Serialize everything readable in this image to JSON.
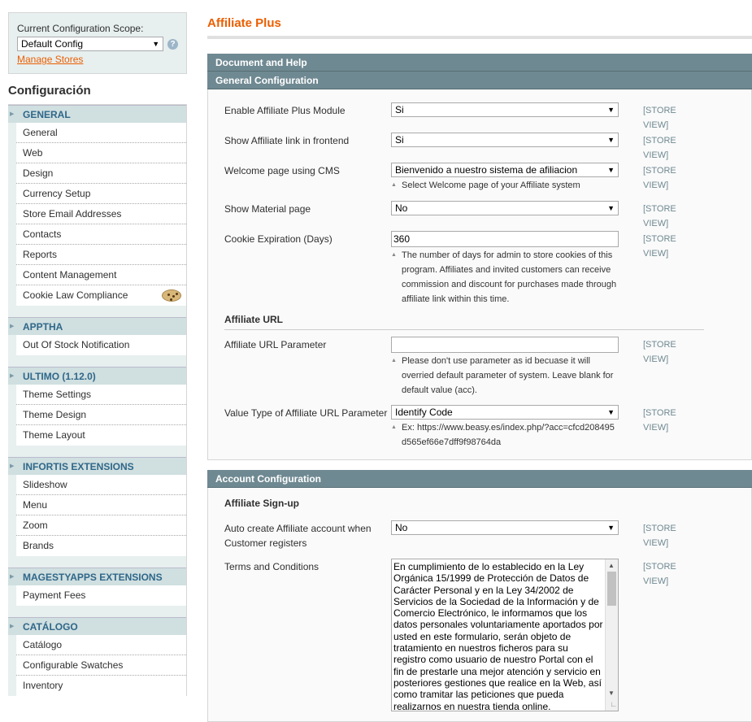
{
  "scope": {
    "label": "Current Configuration Scope:",
    "selected": "Default Config",
    "manage_stores": "Manage Stores"
  },
  "sidebar": {
    "title": "Configuración",
    "groups": [
      {
        "header": "GENERAL",
        "items": [
          "General",
          "Web",
          "Design",
          "Currency Setup",
          "Store Email Addresses",
          "Contacts",
          "Reports",
          "Content Management",
          "Cookie Law Compliance"
        ]
      },
      {
        "header": "APPTHA",
        "items": [
          "Out Of Stock Notification"
        ]
      },
      {
        "header": "ULTIMO (1.12.0)",
        "items": [
          "Theme Settings",
          "Theme Design",
          "Theme Layout"
        ]
      },
      {
        "header": "INFORTIS EXTENSIONS",
        "items": [
          "Slideshow",
          "Menu",
          "Zoom",
          "Brands"
        ]
      },
      {
        "header": "MAGESTYAPPS EXTENSIONS",
        "items": [
          "Payment Fees"
        ]
      },
      {
        "header": "CATÁLOGO",
        "items": [
          "Catálogo",
          "Configurable Swatches",
          "Inventory"
        ]
      }
    ]
  },
  "main": {
    "title": "Affiliate Plus",
    "doc_help": "Document and Help",
    "general": {
      "header": "General Configuration",
      "enable_label": "Enable Affiliate Plus Module",
      "enable_value": "Si",
      "show_link_label": "Show Affiliate link in frontend",
      "show_link_value": "Si",
      "welcome_label": "Welcome page using CMS",
      "welcome_value": "Bienvenido a nuestro sistema de afiliacion",
      "welcome_note": "Select Welcome page of your Affiliate system",
      "material_label": "Show Material page",
      "material_value": "No",
      "cookie_label": "Cookie Expiration (Days)",
      "cookie_value": "360",
      "cookie_note": "The number of days for admin to store cookies of this program. Affiliates and invited customers can receive commission and discount for purchases made through affiliate link within this time.",
      "url_subhead": "Affiliate URL",
      "url_param_label": "Affiliate URL Parameter",
      "url_param_value": "",
      "url_param_note": "Please don't use parameter as id becuase it will overried default parameter of system. Leave blank for default value (acc).",
      "value_type_label": "Value Type of Affiliate URL Parameter",
      "value_type_value": "Identify Code",
      "value_type_note": "Ex: https://www.beasy.es/index.php/?acc=cfcd208495d565ef66e7dff9f98764da"
    },
    "account": {
      "header": "Account Configuration",
      "signup_subhead": "Affiliate Sign-up",
      "auto_create_label": "Auto create Affiliate account when Customer registers",
      "auto_create_value": "No",
      "terms_label": "Terms and Conditions",
      "terms_value": "En cumplimiento de lo establecido en la Ley Orgánica 15/1999 de Protección de Datos de Carácter Personal y en la Ley 34/2002 de Servicios de la Sociedad de la Información y de Comercio Electrónico, le informamos que los datos personales voluntariamente aportados por usted en este formulario, serán objeto de tratamiento en nuestros ficheros para su registro como usuario de nuestro Portal con el fin de prestarle una mejor atención y servicio en posteriores gestiones que realice en la Web, así como tramitar las peticiones que pueda realizarnos en nuestra tienda online."
    },
    "store_view": "[STORE VIEW]"
  }
}
